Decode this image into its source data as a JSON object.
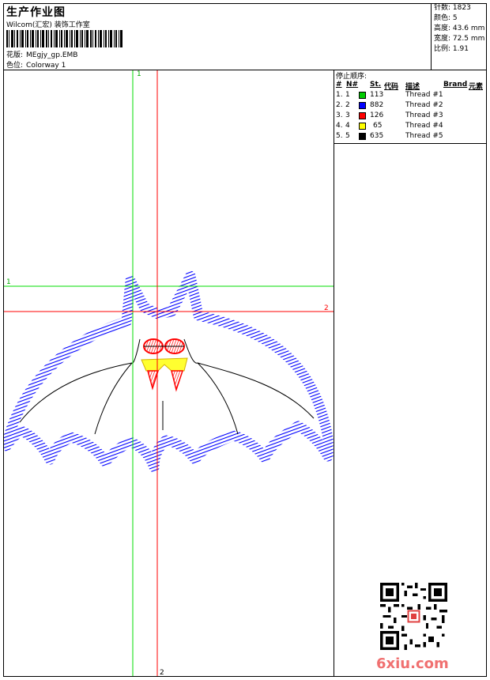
{
  "header": {
    "title": "生产作业图",
    "subtitle": "Wilcom(汇宏) 装饰工作室",
    "design_label": "花版:",
    "design_file": "MEgjy_gp.EMB",
    "colorway_label": "色位:",
    "colorway": "Colorway 1"
  },
  "stats": [
    {
      "label": "针数:",
      "value": "1823"
    },
    {
      "label": "颜色:",
      "value": "5"
    },
    {
      "label": "高度:",
      "value": "43.6 mm"
    },
    {
      "label": "宽度:",
      "value": "72.5 mm"
    },
    {
      "label": "比例:",
      "value": "1.91"
    }
  ],
  "stop_sequence": {
    "title": "停止顺序:",
    "headers": [
      "#",
      "N#",
      "St.",
      "代码",
      "描述",
      "Brand",
      "元素"
    ],
    "rows": [
      {
        "num": "1.",
        "n": "1",
        "code": "113",
        "desc": "Thread #1",
        "color": "#00cc00"
      },
      {
        "num": "2.",
        "n": "2",
        "code": "882",
        "desc": "Thread #2",
        "color": "#0000ff"
      },
      {
        "num": "3.",
        "n": "3",
        "code": "126",
        "desc": "Thread #3",
        "color": "#ff0000"
      },
      {
        "num": "4.",
        "n": "4",
        "code": "65",
        "desc": "Thread #4",
        "color": "#ffff00"
      },
      {
        "num": "5.",
        "n": "5",
        "code": "635",
        "desc": "Thread #5",
        "color": "#000000"
      }
    ]
  },
  "guides": {
    "green_label": "1",
    "red_label": "2",
    "green_color": "#00dd00",
    "red_color": "#ff0000"
  },
  "watermark": "6xiu.com"
}
